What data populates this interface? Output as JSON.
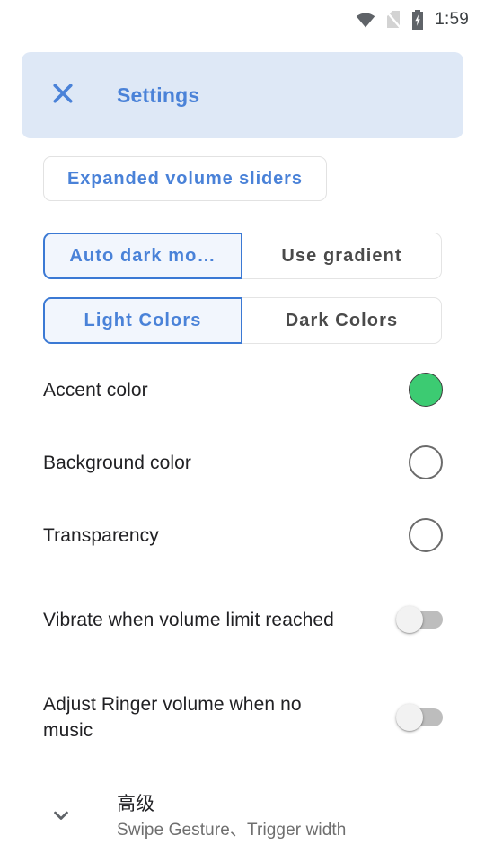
{
  "status_bar": {
    "wifi_icon": "wifi-icon",
    "no_sim_icon": "no-sim-icon",
    "battery_icon": "battery-charging-icon",
    "time": "1:59"
  },
  "header": {
    "close_icon": "close-icon",
    "title": "Settings",
    "background_color": "#dee8f6",
    "accent_color": "#4a82d8"
  },
  "expanded_button": {
    "label": "Expanded volume sliders"
  },
  "segmented_controls": [
    {
      "name": "dark-mode-mode",
      "options": [
        {
          "label": "Auto dark mo…",
          "selected": true
        },
        {
          "label": "Use gradient",
          "selected": false
        }
      ]
    },
    {
      "name": "color-scheme",
      "options": [
        {
          "label": "Light Colors",
          "selected": true
        },
        {
          "label": "Dark Colors",
          "selected": false
        }
      ]
    }
  ],
  "color_rows": [
    {
      "label": "Accent color",
      "swatch": "#3ccb72",
      "filled": true
    },
    {
      "label": "Background color",
      "swatch": "#ffffff",
      "filled": false
    },
    {
      "label": "Transparency",
      "swatch": "#ffffff",
      "filled": false
    }
  ],
  "toggle_rows": [
    {
      "label": "Vibrate when volume limit reached",
      "checked": false
    },
    {
      "label": "Adjust Ringer volume when no music",
      "checked": false
    }
  ],
  "advanced": {
    "expand_icon": "chevron-down-icon",
    "title": "高级",
    "subtitle": "Swipe Gesture、Trigger width"
  }
}
